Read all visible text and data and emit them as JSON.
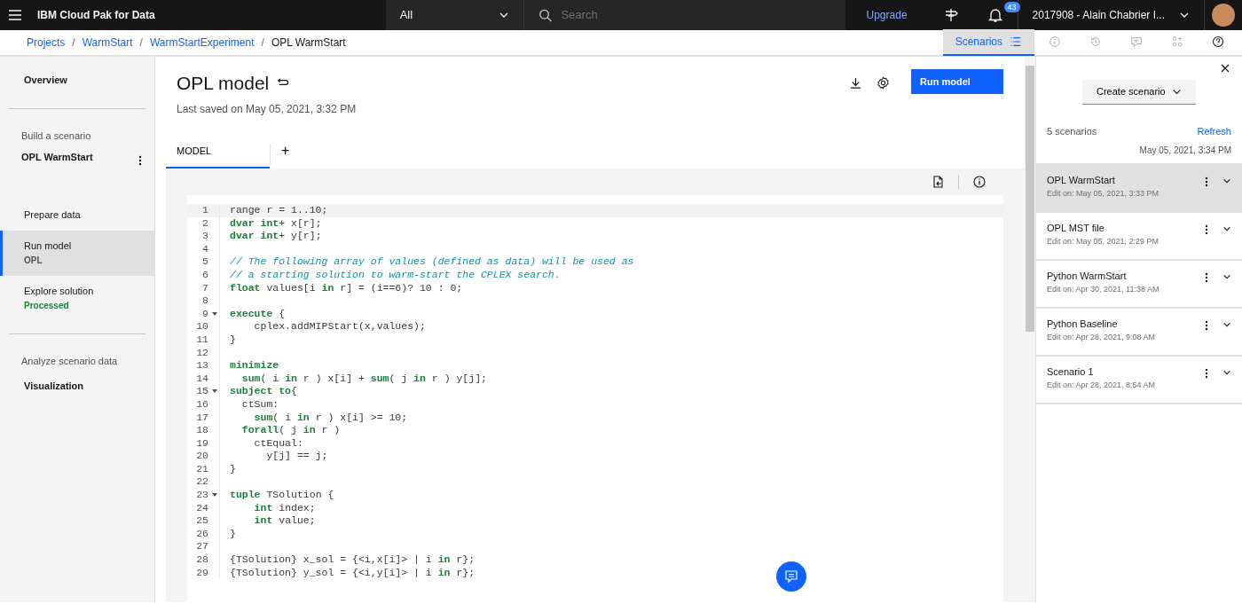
{
  "header": {
    "product": "IBM Cloud Pak for Data",
    "scope": "All",
    "search_placeholder": "Search",
    "upgrade": "Upgrade",
    "notifications": "43",
    "account": "2017908 - Alain Chabrier I..."
  },
  "breadcrumbs": [
    {
      "kind": "link",
      "label": "Projects"
    },
    {
      "kind": "separator",
      "label": "/"
    },
    {
      "kind": "link",
      "label": "WarmStart"
    },
    {
      "kind": "separator",
      "label": "/"
    },
    {
      "kind": "link",
      "label": "WarmStartExperiment"
    },
    {
      "kind": "separator",
      "label": "/"
    },
    {
      "kind": "current",
      "label": "OPL WarmStart"
    }
  ],
  "panel_tabs": [
    {
      "kind": "scenarios",
      "label": "Scenarios",
      "selected": true
    },
    {
      "kind": "info",
      "selected": false
    },
    {
      "kind": "history",
      "selected": false
    },
    {
      "kind": "comment",
      "selected": false
    },
    {
      "kind": "nodes",
      "selected": false
    },
    {
      "kind": "help",
      "selected": false
    }
  ],
  "sidebar": {
    "items": [
      {
        "kind": "link",
        "label": "Overview",
        "bold": true,
        "selected": false
      },
      {
        "kind": "divider"
      },
      {
        "kind": "group",
        "label": "Build a scenario"
      },
      {
        "kind": "scenario",
        "label": "OPL WarmStart"
      },
      {
        "kind": "link",
        "label": "Prepare data",
        "bold": false,
        "selected": false
      },
      {
        "kind": "link",
        "label": "Run model",
        "sub": "OPL",
        "color": "#525252",
        "bold": false,
        "selected": true
      },
      {
        "kind": "link",
        "label": "Explore solution",
        "sub": "Processed",
        "color": "#198038",
        "bold": false,
        "selected": false
      },
      {
        "kind": "divider"
      },
      {
        "kind": "group",
        "label": "Analyze scenario data"
      },
      {
        "kind": "link",
        "label": "Visualization",
        "bold": true,
        "selected": false
      }
    ]
  },
  "main": {
    "title": "OPL model",
    "saved": "Last saved on May 05, 2021, 3:32 PM",
    "run_button": "Run model",
    "tabs": [
      {
        "label": "MODEL",
        "selected": true
      }
    ],
    "add_tab": "+",
    "code": [
      {
        "number": "1",
        "current": true,
        "fold": false,
        "kind": "code",
        "text": "range r = 1..10;"
      },
      {
        "number": "2",
        "current": false,
        "fold": false,
        "kind": "code",
        "text": "**dvar int**+ x[r];"
      },
      {
        "number": "3",
        "current": false,
        "fold": false,
        "kind": "code",
        "text": "**dvar int**+ y[r];"
      },
      {
        "number": "4",
        "current": false,
        "fold": false
      },
      {
        "number": "5",
        "current": false,
        "fold": false,
        "kind": "comment",
        "text": "// The following array of values (defined as data) will be used as"
      },
      {
        "number": "6",
        "current": false,
        "fold": false,
        "kind": "comment",
        "text": "// a starting solution to warm-start the CPLEX search."
      },
      {
        "number": "7",
        "current": false,
        "fold": false,
        "kind": "code",
        "text": "**float** values[i **in** r] = (i==6)? 10 : 0;"
      },
      {
        "number": "8",
        "current": false,
        "fold": false
      },
      {
        "number": "9",
        "current": false,
        "fold": true,
        "kind": "code",
        "text": "**execute** {"
      },
      {
        "number": "10",
        "current": false,
        "fold": false,
        "kind": "code",
        "text": "    cplex.addMIPStart(x,values);"
      },
      {
        "number": "11",
        "current": false,
        "fold": false,
        "kind": "code",
        "text": "}"
      },
      {
        "number": "12",
        "current": false,
        "fold": false
      },
      {
        "number": "13",
        "current": false,
        "fold": false,
        "kind": "code",
        "text": "**minimize**"
      },
      {
        "number": "14",
        "current": false,
        "fold": false,
        "kind": "code",
        "text": "  **sum**( i **in** r ) x[i] + **sum**( j **in** r ) y[j];"
      },
      {
        "number": "15",
        "current": false,
        "fold": true,
        "kind": "code",
        "text": "**subject to**{"
      },
      {
        "number": "16",
        "current": false,
        "fold": false,
        "kind": "code",
        "text": "  ctSum:"
      },
      {
        "number": "17",
        "current": false,
        "fold": false,
        "kind": "code",
        "text": "    **sum**( i **in** r ) x[i] >= 10;"
      },
      {
        "number": "18",
        "current": false,
        "fold": false,
        "kind": "code",
        "text": "  **forall**( j **in** r )"
      },
      {
        "number": "19",
        "current": false,
        "fold": false,
        "kind": "code",
        "text": "    ctEqual:"
      },
      {
        "number": "20",
        "current": false,
        "fold": false,
        "kind": "code",
        "text": "      y[j] == j;"
      },
      {
        "number": "21",
        "current": false,
        "fold": false,
        "kind": "code",
        "text": "}"
      },
      {
        "number": "22",
        "current": false,
        "fold": false
      },
      {
        "number": "23",
        "current": false,
        "fold": true,
        "kind": "code",
        "text": "**tuple** TSolution {"
      },
      {
        "number": "24",
        "current": false,
        "fold": false,
        "kind": "code",
        "text": "    **int** index;"
      },
      {
        "number": "25",
        "current": false,
        "fold": false,
        "kind": "code",
        "text": "    **int** value;"
      },
      {
        "number": "26",
        "current": false,
        "fold": false,
        "kind": "code",
        "text": "}"
      },
      {
        "number": "27",
        "current": false,
        "fold": false
      },
      {
        "number": "28",
        "current": false,
        "fold": false,
        "kind": "code",
        "text": "{TSolution} x_sol = {<i,x[i]> | i **in** r};"
      },
      {
        "number": "29",
        "current": false,
        "fold": false,
        "kind": "code",
        "text": "{TSolution} y_sol = {<i,y[i]> | i **in** r};"
      }
    ]
  },
  "scenarios_panel": {
    "create": "Create scenario",
    "count": "5 scenarios",
    "refresh": "Refresh",
    "refreshed": "May 05, 2021, 3:34 PM",
    "items": [
      {
        "name": "OPL WarmStart",
        "edited": "Edit on: May 05, 2021, 3:33 PM",
        "selected": true
      },
      {
        "name": "OPL MST file",
        "edited": "Edit on: May 05, 2021, 2:29 PM",
        "selected": false
      },
      {
        "name": "Python WarmStart",
        "edited": "Edit on: Apr 30, 2021, 11:38 AM",
        "selected": false
      },
      {
        "name": "Python Baseline",
        "edited": "Edit on: Apr 28, 2021, 9:08 AM",
        "selected": false
      },
      {
        "name": "Scenario 1",
        "edited": "Edit on: Apr 28, 2021, 8:54 AM",
        "selected": false
      }
    ]
  }
}
